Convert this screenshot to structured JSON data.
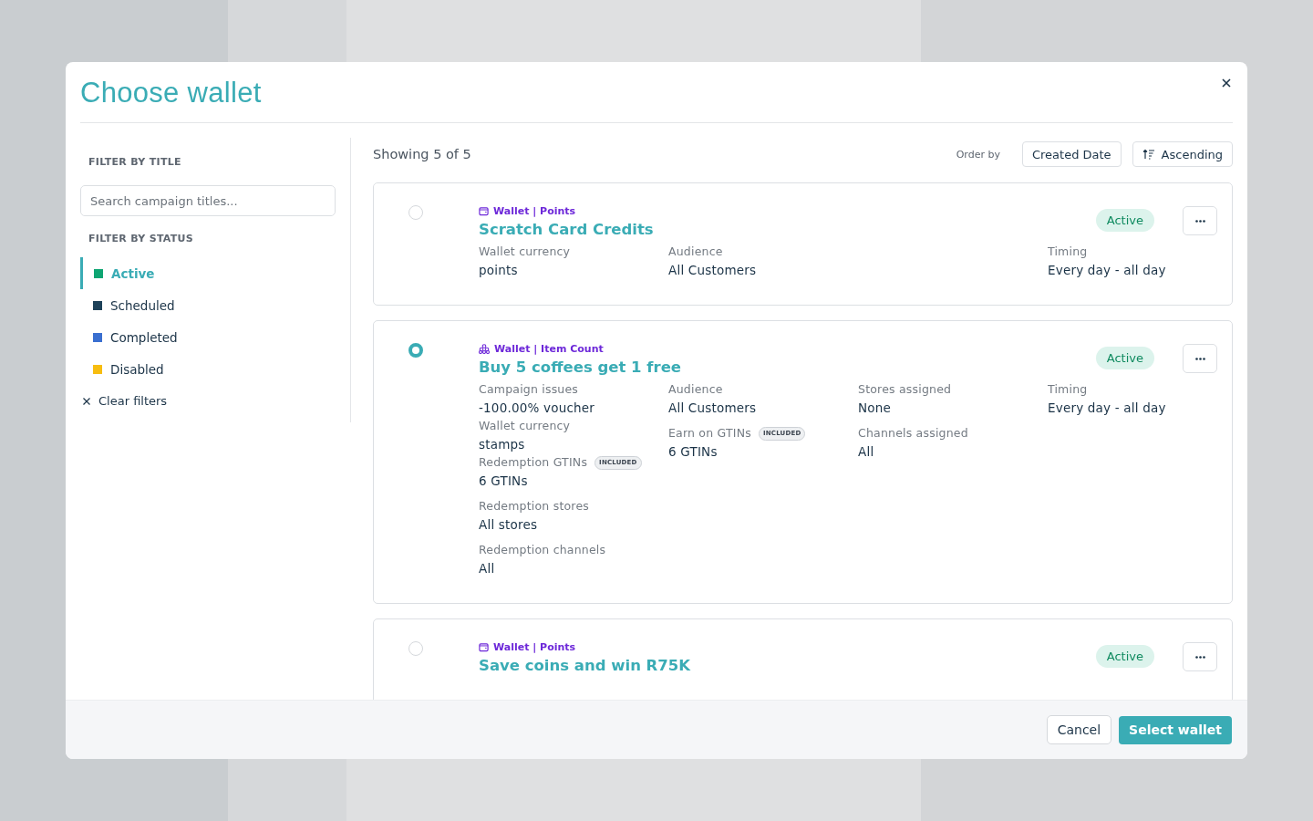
{
  "modal": {
    "title": "Choose wallet"
  },
  "filters": {
    "title_heading": "FILTER BY TITLE",
    "search": {
      "placeholder": "Search campaign titles..."
    },
    "status_heading": "FILTER BY STATUS",
    "statuses": [
      {
        "label": "Active",
        "color": "#0ea572",
        "selected": true
      },
      {
        "label": "Scheduled",
        "color": "#1e4259",
        "selected": false
      },
      {
        "label": "Completed",
        "color": "#3a6fd0",
        "selected": false
      },
      {
        "label": "Disabled",
        "color": "#f7bd10",
        "selected": false
      }
    ],
    "clear": "Clear filters"
  },
  "results": {
    "showing": "Showing 5 of 5",
    "order_label": "Order by",
    "order_field": "Created Date",
    "order_direction": "Ascending"
  },
  "wallets": [
    {
      "kind": "wallet",
      "tag": "Wallet | Points",
      "title": "Scratch Card Credits",
      "status": "Active",
      "selected": false,
      "columns": [
        [
          {
            "label": "Wallet currency",
            "value": "points"
          }
        ],
        [
          {
            "label": "Audience",
            "value": "All Customers"
          }
        ],
        [],
        [
          {
            "label": "Timing",
            "value": "Every day - all day"
          }
        ]
      ]
    },
    {
      "kind": "item-count",
      "tag": "Wallet | Item Count",
      "title": "Buy 5 coffees get 1 free",
      "status": "Active",
      "selected": true,
      "columns": [
        [
          {
            "label": "Campaign issues",
            "value": "-100.00% voucher"
          },
          {
            "label": "Wallet currency",
            "value": "stamps"
          },
          {
            "label": "Redemption GTINs",
            "value": "6 GTINs",
            "badge": "INCLUDED"
          },
          {
            "label": "Redemption stores",
            "value": "All stores"
          },
          {
            "label": "Redemption channels",
            "value": "All"
          }
        ],
        [
          {
            "label": "Audience",
            "value": "All Customers"
          },
          {
            "label": "Earn on GTINs",
            "value": "6 GTINs",
            "badge": "INCLUDED"
          }
        ],
        [
          {
            "label": "Stores assigned",
            "value": "None"
          },
          {
            "label": "Channels assigned",
            "value": "All"
          }
        ],
        [
          {
            "label": "Timing",
            "value": "Every day - all day"
          }
        ]
      ]
    },
    {
      "kind": "wallet",
      "tag": "Wallet | Points",
      "title": "Save coins and win R75K",
      "status": "Active",
      "selected": false
    }
  ],
  "footer": {
    "cancel": "Cancel",
    "confirm": "Select wallet"
  }
}
